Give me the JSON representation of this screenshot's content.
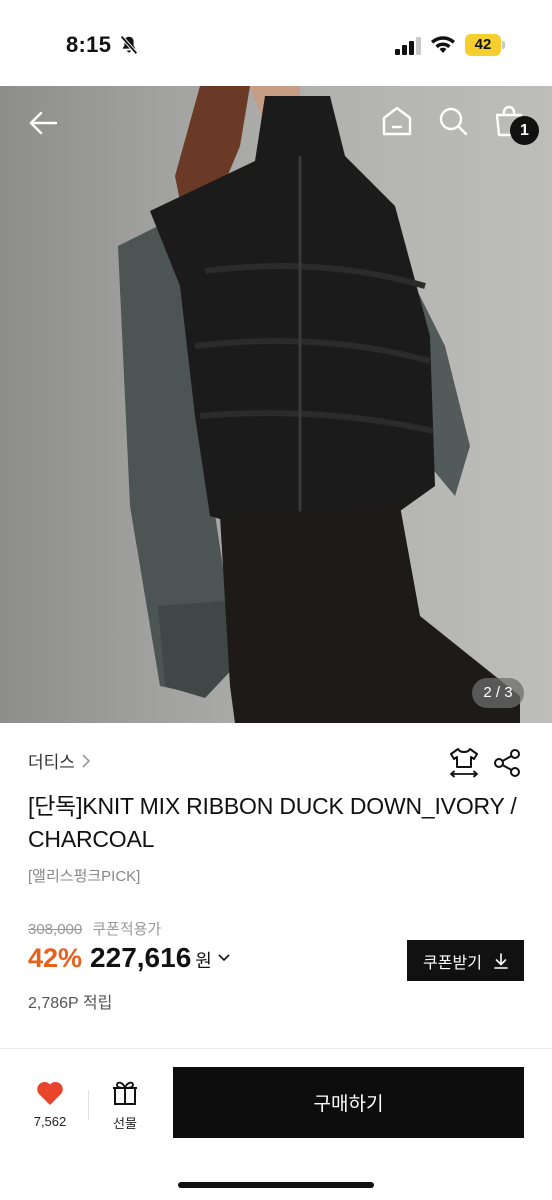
{
  "status_bar": {
    "time": "8:15",
    "battery": "42"
  },
  "hero": {
    "image_counter": "2 / 3",
    "cart_count": "1"
  },
  "product": {
    "brand": "더티스",
    "title": "[단독]KNIT MIX RIBBON DUCK DOWN_IVORY / CHARCOAL",
    "tag": "[앨리스펑크PICK]",
    "original_price": "308,000",
    "coupon_price_label": "쿠폰적용가",
    "discount": "42%",
    "sale_price": "227,616",
    "currency": "원",
    "points": "2,786P 적립"
  },
  "actions": {
    "coupon_button": "쿠폰받기"
  },
  "bottom_bar": {
    "like_count": "7,562",
    "gift_label": "선물",
    "buy_label": "구매하기"
  },
  "colors": {
    "accent": "#e8601c",
    "heart": "#e8452c",
    "button": "#111111"
  }
}
